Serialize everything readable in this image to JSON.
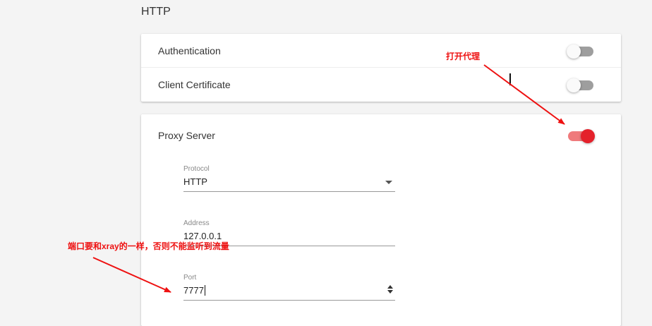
{
  "section": {
    "title": "HTTP"
  },
  "settings": {
    "authentication": {
      "label": "Authentication",
      "enabled": false
    },
    "client_certificate": {
      "label": "Client Certificate",
      "enabled": false
    },
    "proxy_server": {
      "label": "Proxy Server",
      "enabled": true
    }
  },
  "proxy_form": {
    "protocol": {
      "label": "Protocol",
      "value": "HTTP"
    },
    "address": {
      "label": "Address",
      "value": "127.0.0.1"
    },
    "port": {
      "label": "Port",
      "value": "7777"
    }
  },
  "annotations": {
    "enable_proxy": "打开代理",
    "port_note": "端口要和xray的一样，否则不能监听到流量"
  },
  "colors": {
    "toggle_on_thumb": "#e4212b",
    "toggle_on_track": "#ef7a7c",
    "toggle_off_track": "#9e9e9e",
    "annotation": "#ee1111"
  }
}
